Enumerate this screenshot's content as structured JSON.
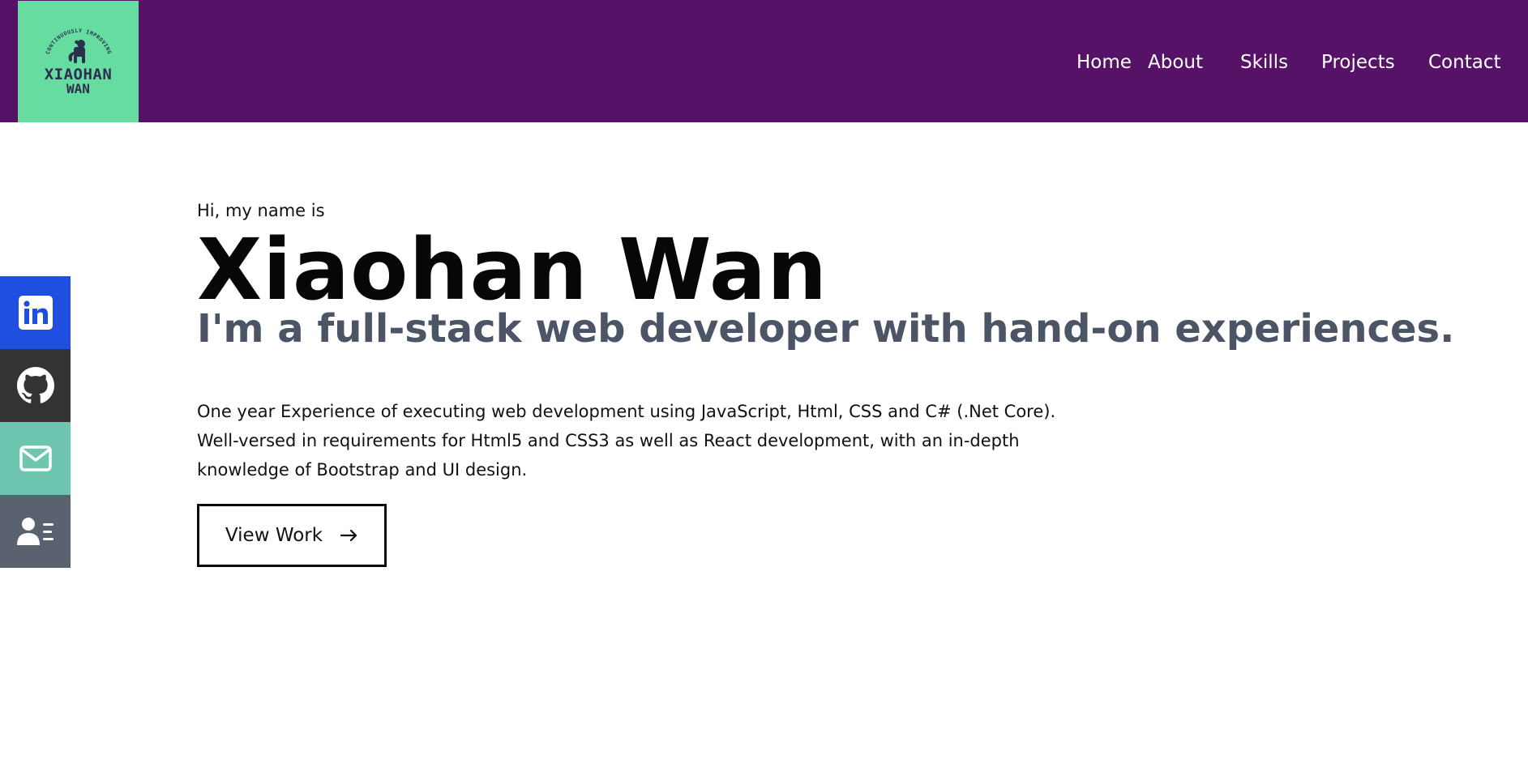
{
  "header": {
    "logo": {
      "arc_text": "CONTINUOUSLY IMPROVING",
      "line1": "XIAOHAN",
      "line2": "WAN",
      "icon": "monkey-icon"
    },
    "nav": [
      {
        "label": "Home"
      },
      {
        "label": "About"
      },
      {
        "label": "Skills"
      },
      {
        "label": "Projects"
      },
      {
        "label": "Contact"
      }
    ],
    "background_color": "#561266",
    "logo_color": "#66dca0"
  },
  "social": [
    {
      "name": "linkedin",
      "icon": "linkedin-icon",
      "color": "#1f4fe0"
    },
    {
      "name": "github",
      "icon": "github-icon",
      "color": "#333333"
    },
    {
      "name": "email",
      "icon": "mail-icon",
      "color": "#6ec6b0"
    },
    {
      "name": "resume",
      "icon": "contact-card-icon",
      "color": "#5a6270"
    }
  ],
  "hero": {
    "greeting": "Hi, my name is",
    "name": "Xiaohan Wan",
    "tagline": "I'm a full-stack web developer with hand-on experiences.",
    "description": [
      "One year Experience of executing web development using JavaScript, Html, CSS and C# (.Net Core).",
      "Well-versed in requirements for Html5 and CSS3 as well as React development, with an in-depth",
      "knowledge of Bootstrap and UI design."
    ],
    "button_label": "View Work",
    "button_icon": "arrow-right-icon"
  }
}
